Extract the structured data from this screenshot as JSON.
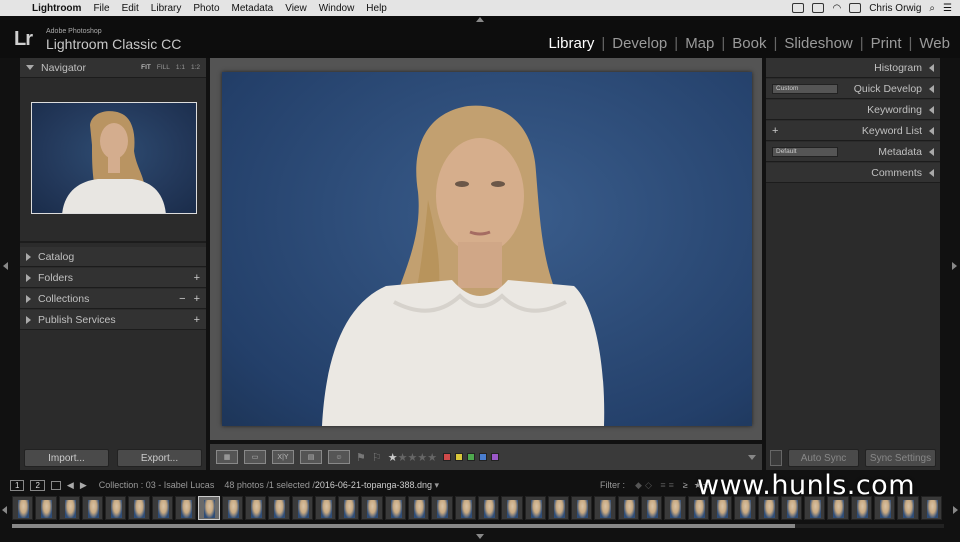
{
  "menubar": {
    "apple_icon": "apple-icon",
    "items": [
      "Lightroom",
      "File",
      "Edit",
      "Library",
      "Photo",
      "Metadata",
      "View",
      "Window",
      "Help"
    ],
    "user": "Chris Orwig"
  },
  "brand": {
    "logo": "Lr",
    "small": "Adobe Photoshop",
    "name": "Lightroom Classic CC"
  },
  "modules": [
    "Library",
    "Develop",
    "Map",
    "Book",
    "Slideshow",
    "Print",
    "Web"
  ],
  "active_module": "Library",
  "left_panel": {
    "navigator": {
      "title": "Navigator",
      "zooms": [
        "FIT",
        "FILL",
        "1:1",
        "1:2"
      ]
    },
    "sections": [
      {
        "label": "Catalog",
        "plus": "",
        "minus": ""
      },
      {
        "label": "Folders",
        "plus": "+",
        "minus": ""
      },
      {
        "label": "Collections",
        "plus": "+",
        "minus": "−"
      },
      {
        "label": "Publish Services",
        "plus": "+",
        "minus": ""
      }
    ],
    "import_label": "Import...",
    "export_label": "Export..."
  },
  "right_panel": {
    "sections": [
      {
        "label": "Histogram",
        "select": "",
        "plus": ""
      },
      {
        "label": "Quick Develop",
        "select": "Custom",
        "plus": ""
      },
      {
        "label": "Keywording",
        "select": "",
        "plus": ""
      },
      {
        "label": "Keyword List",
        "select": "",
        "plus": "+"
      },
      {
        "label": "Metadata",
        "select": "Default",
        "plus": ""
      },
      {
        "label": "Comments",
        "select": "",
        "plus": ""
      }
    ],
    "auto_sync_label": "Auto Sync",
    "sync_settings_label": "Sync Settings"
  },
  "toolbar": {
    "views": [
      "grid",
      "loupe",
      "X|Y",
      "survey",
      "people"
    ],
    "colors": [
      "#d04a4a",
      "#d8c63a",
      "#4ea84e",
      "#4a7ed0",
      "#9a58c8"
    ]
  },
  "filmstrip_bar": {
    "screen1": "1",
    "screen2": "2",
    "collection": "Collection : 03 - Isabel Lucas",
    "count": "48 photos /1 selected /",
    "filename": "2016-06-21-topanga-388.dng",
    "filter_label": "Filter :",
    "filter_sep": "≥"
  },
  "watermark": "www.hunls.com",
  "filmstrip": {
    "total": 48,
    "selected_index": 8,
    "scroll_fraction": 0.84
  }
}
